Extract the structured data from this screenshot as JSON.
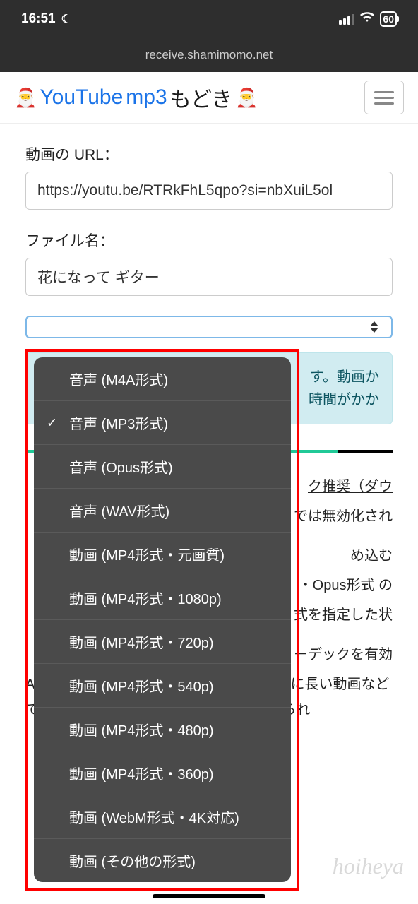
{
  "statusBar": {
    "time": "16:51",
    "battery": "60"
  },
  "urlBar": {
    "domain": "receive.shamimomo.net"
  },
  "header": {
    "logoYoutube": "YouTube",
    "logoMp3": "mp3",
    "logoSuffix": "もどき"
  },
  "form": {
    "urlLabel": "動画の URL：",
    "urlValue": "https://youtu.be/RTRkFhL5qpo?si=nbXuiL5ol",
    "filenameLabel": "ファイル名：",
    "filenameValue": "花になって ギター"
  },
  "dropdown": {
    "items": [
      {
        "label": "音声 (M4A形式)",
        "selected": false
      },
      {
        "label": "音声 (MP3形式)",
        "selected": true
      },
      {
        "label": "音声 (Opus形式)",
        "selected": false
      },
      {
        "label": "音声 (WAV形式)",
        "selected": false
      },
      {
        "label": "動画 (MP4形式・元画質)",
        "selected": false
      },
      {
        "label": "動画 (MP4形式・1080p)",
        "selected": false
      },
      {
        "label": "動画 (MP4形式・720p)",
        "selected": false
      },
      {
        "label": "動画 (MP4形式・540p)",
        "selected": false
      },
      {
        "label": "動画 (MP4形式・480p)",
        "selected": false
      },
      {
        "label": "動画 (MP4形式・360p)",
        "selected": false
      },
      {
        "label": "動画 (WebM形式・4K対応)",
        "selected": false
      },
      {
        "label": "動画 (その他の形式)",
        "selected": false
      }
    ]
  },
  "infoBox": {
    "line1": "す。動画か",
    "line2": "時間がかか"
  },
  "options": {
    "line1a": "ク推奨（ダウ",
    "line1b": "では無効化され",
    "line2a": "め込む",
    "line2b": "・Opus形式 の",
    "line2c": "式を指定した状",
    "line3a": "ーデックを有効",
    "line4": "AV1 / VP9 は新しい動画コーデックで、特に長い動画などでは H.264 よりもファイルサイズを抑えられ"
  },
  "watermark": "hoiheya"
}
